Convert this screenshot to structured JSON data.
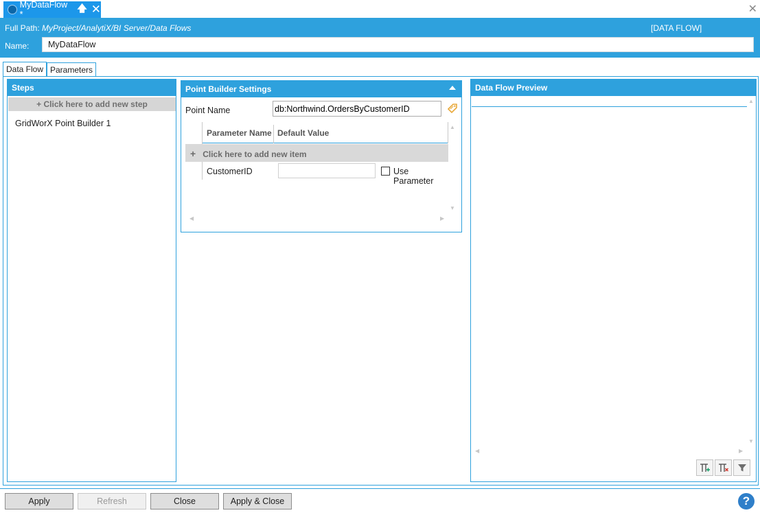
{
  "document_tab": {
    "title": "MyDataFlow *",
    "pin_icon": "pin-up-icon",
    "close_icon": "close-icon"
  },
  "window": {
    "close_icon": "close-icon"
  },
  "header": {
    "full_path_label": "Full Path:",
    "full_path_value": "MyProject/AnalytiX/BI Server/Data Flows",
    "type_label": "[DATA FLOW]",
    "name_label": "Name:",
    "name_value": "MyDataFlow"
  },
  "tabs": [
    {
      "label": "Data Flow",
      "active": true
    },
    {
      "label": "Parameters",
      "active": false
    }
  ],
  "steps_panel": {
    "title": "Steps",
    "add_step": "+  Click here to add new step",
    "items": [
      "GridWorX Point Builder  1"
    ]
  },
  "settings_panel": {
    "title": "Point Builder Settings",
    "point_name_label": "Point Name",
    "point_name_value": "db:Northwind.OrdersByCustomerID",
    "grid": {
      "columns": [
        "Parameter Name",
        "Default Value"
      ],
      "add_item": "Click here to add new item",
      "rows": [
        {
          "name": "CustomerID",
          "default": "",
          "use_parameter_label": "Use Parameter",
          "use_parameter": false
        }
      ]
    }
  },
  "preview_panel": {
    "title": "Data Flow Preview"
  },
  "buttons": {
    "apply": "Apply",
    "refresh": "Refresh",
    "close": "Close",
    "apply_close": "Apply & Close"
  },
  "help": {
    "glyph": "?"
  },
  "colors": {
    "accent": "#2ea1dd",
    "tab_active": "#1c97ea"
  }
}
